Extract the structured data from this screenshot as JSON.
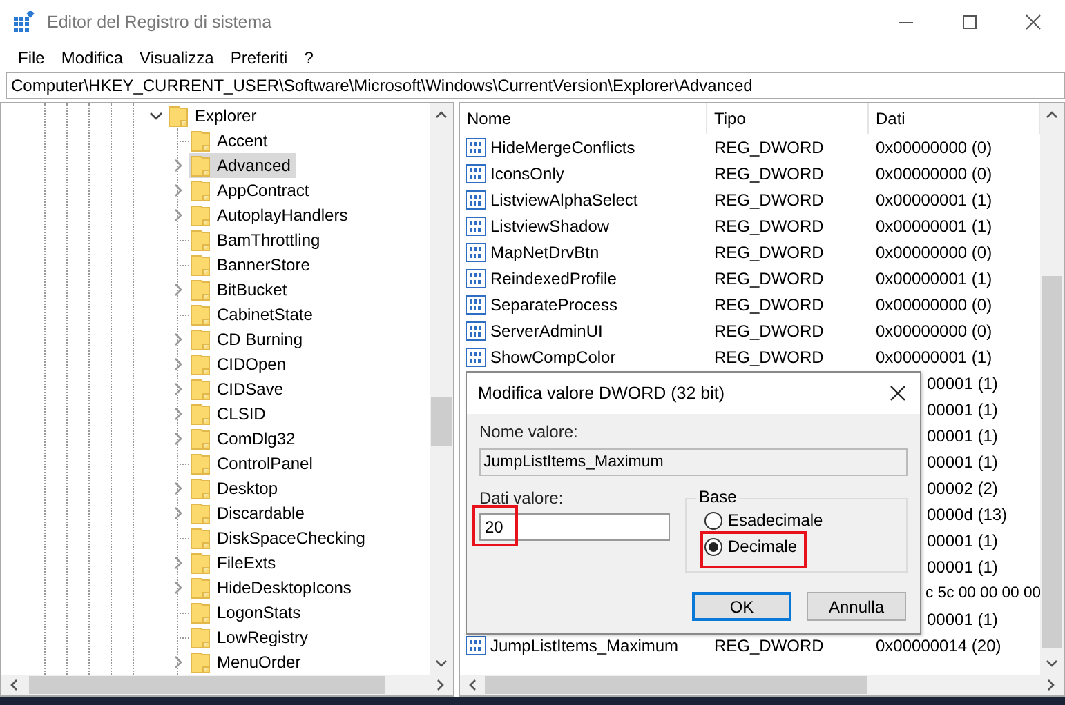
{
  "window": {
    "title": "Editor del Registro di sistema"
  },
  "menu": [
    "File",
    "Modifica",
    "Visualizza",
    "Preferiti",
    "?"
  ],
  "address": "Computer\\HKEY_CURRENT_USER\\Software\\Microsoft\\Windows\\CurrentVersion\\Explorer\\Advanced",
  "tree": [
    {
      "label": "Explorer",
      "expanded": true,
      "selected": false,
      "children": [
        {
          "label": "Accent",
          "expandable": false,
          "selected": false
        },
        {
          "label": "Advanced",
          "expandable": true,
          "selected": true
        },
        {
          "label": "AppContract",
          "expandable": true,
          "selected": false
        },
        {
          "label": "AutoplayHandlers",
          "expandable": true,
          "selected": false
        },
        {
          "label": "BamThrottling",
          "expandable": false,
          "selected": false
        },
        {
          "label": "BannerStore",
          "expandable": false,
          "selected": false
        },
        {
          "label": "BitBucket",
          "expandable": true,
          "selected": false
        },
        {
          "label": "CabinetState",
          "expandable": false,
          "selected": false
        },
        {
          "label": "CD Burning",
          "expandable": true,
          "selected": false
        },
        {
          "label": "CIDOpen",
          "expandable": true,
          "selected": false
        },
        {
          "label": "CIDSave",
          "expandable": true,
          "selected": false
        },
        {
          "label": "CLSID",
          "expandable": true,
          "selected": false
        },
        {
          "label": "ComDlg32",
          "expandable": true,
          "selected": false
        },
        {
          "label": "ControlPanel",
          "expandable": false,
          "selected": false
        },
        {
          "label": "Desktop",
          "expandable": true,
          "selected": false
        },
        {
          "label": "Discardable",
          "expandable": true,
          "selected": false
        },
        {
          "label": "DiskSpaceChecking",
          "expandable": false,
          "selected": false
        },
        {
          "label": "FileExts",
          "expandable": true,
          "selected": false
        },
        {
          "label": "HideDesktopIcons",
          "expandable": true,
          "selected": false
        },
        {
          "label": "LogonStats",
          "expandable": false,
          "selected": false
        },
        {
          "label": "LowRegistry",
          "expandable": false,
          "selected": false
        },
        {
          "label": "MenuOrder",
          "expandable": true,
          "selected": false
        }
      ]
    }
  ],
  "table": {
    "columns": [
      "Nome",
      "Tipo",
      "Dati"
    ],
    "rows": [
      {
        "kind": "full",
        "name": "HideMergeConflicts",
        "type": "REG_DWORD",
        "data": "0x00000000 (0)"
      },
      {
        "kind": "full",
        "name": "IconsOnly",
        "type": "REG_DWORD",
        "data": "0x00000000 (0)"
      },
      {
        "kind": "full",
        "name": "ListviewAlphaSelect",
        "type": "REG_DWORD",
        "data": "0x00000001 (1)"
      },
      {
        "kind": "full",
        "name": "ListviewShadow",
        "type": "REG_DWORD",
        "data": "0x00000001 (1)"
      },
      {
        "kind": "full",
        "name": "MapNetDrvBtn",
        "type": "REG_DWORD",
        "data": "0x00000000 (0)"
      },
      {
        "kind": "full",
        "name": "ReindexedProfile",
        "type": "REG_DWORD",
        "data": "0x00000001 (1)"
      },
      {
        "kind": "full",
        "name": "SeparateProcess",
        "type": "REG_DWORD",
        "data": "0x00000000 (0)"
      },
      {
        "kind": "full",
        "name": "ServerAdminUI",
        "type": "REG_DWORD",
        "data": "0x00000000 (0)"
      },
      {
        "kind": "full",
        "name": "ShowCompColor",
        "type": "REG_DWORD",
        "data": "0x00000001 (1)"
      },
      {
        "kind": "covered",
        "data": "00001 (1)"
      },
      {
        "kind": "covered",
        "data": "00001 (1)"
      },
      {
        "kind": "covered",
        "data": "00001 (1)"
      },
      {
        "kind": "covered",
        "data": "00001 (1)"
      },
      {
        "kind": "covered",
        "data": "00002 (2)"
      },
      {
        "kind": "covered",
        "data": "0000d (13)"
      },
      {
        "kind": "covered",
        "data": "00001 (1)"
      },
      {
        "kind": "covered",
        "data": "00001 (1)"
      },
      {
        "kind": "covered_wide",
        "data": "c 5c 00 00 00 00"
      },
      {
        "kind": "covered",
        "data": "00001 (1)"
      },
      {
        "kind": "full",
        "name": "JumpListItems_Maximum",
        "type": "REG_DWORD",
        "data": "0x00000014 (20)"
      }
    ]
  },
  "dialog": {
    "title": "Modifica valore DWORD (32 bit)",
    "name_label": "Nome valore:",
    "name_value": "JumpListItems_Maximum",
    "data_label": "Dati valore:",
    "data_value": "20",
    "base_label": "Base",
    "bases": [
      {
        "label": "Esadecimale",
        "selected": false
      },
      {
        "label": "Decimale",
        "selected": true
      }
    ],
    "buttons": [
      {
        "label": "OK",
        "default": true
      },
      {
        "label": "Annulla",
        "default": false
      }
    ]
  }
}
